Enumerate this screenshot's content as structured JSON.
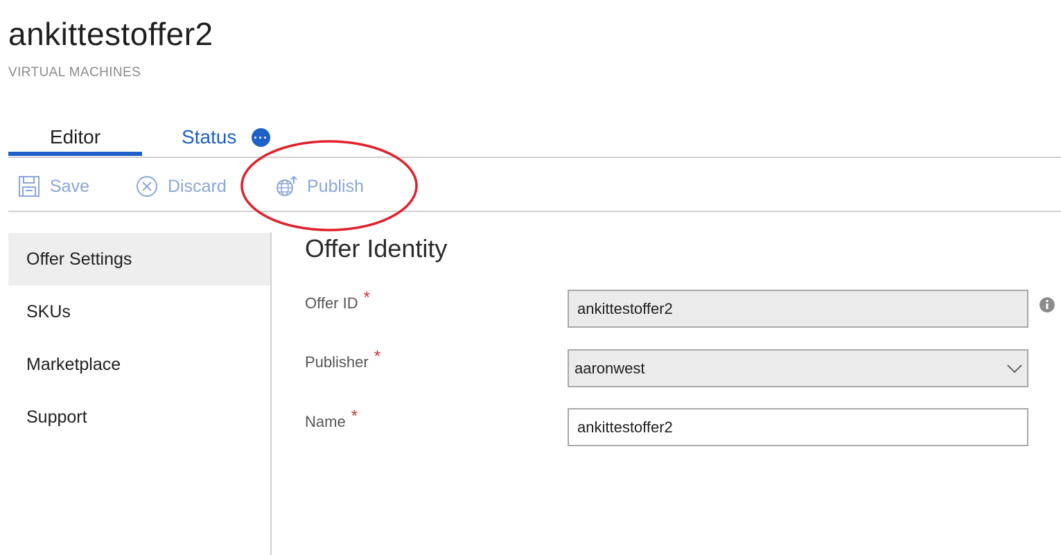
{
  "header": {
    "title": "ankittestoffer2",
    "subtitle": "VIRTUAL MACHINES"
  },
  "tabs": [
    {
      "label": "Editor",
      "active": true
    },
    {
      "label": "Status",
      "active": false
    }
  ],
  "toolbar": {
    "save_label": "Save",
    "discard_label": "Discard",
    "publish_label": "Publish"
  },
  "sidebar": {
    "items": [
      {
        "label": "Offer Settings",
        "active": true
      },
      {
        "label": "SKUs",
        "active": false
      },
      {
        "label": "Marketplace",
        "active": false
      },
      {
        "label": "Support",
        "active": false
      }
    ]
  },
  "form": {
    "section_title": "Offer Identity",
    "required_mark": "*",
    "fields": [
      {
        "label": "Offer ID",
        "value": "ankittestoffer2",
        "type": "readonly"
      },
      {
        "label": "Publisher",
        "value": "aaronwest",
        "type": "select"
      },
      {
        "label": "Name",
        "value": "ankittestoffer2",
        "type": "text"
      }
    ]
  },
  "colors": {
    "accent": "#1e5fc8",
    "toolbar_disabled": "#8aa6d8",
    "required": "#d13438",
    "highlight": "#e0202a"
  },
  "icons": {
    "save": "save-icon",
    "discard": "discard-icon",
    "publish": "publish-globe-icon",
    "status_more": "more-icon",
    "info": "info-icon",
    "dropdown": "chevron-down-icon"
  }
}
